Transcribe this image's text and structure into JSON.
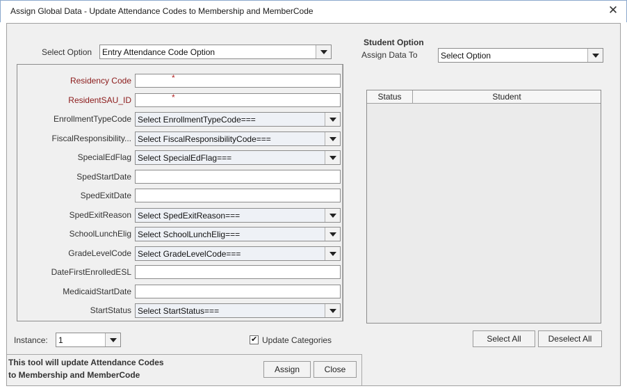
{
  "window": {
    "title": "Assign Global Data - Update Attendance Codes to Membership and MemberCode",
    "close_glyph": "✕"
  },
  "left": {
    "select_option_label": "Select Option",
    "select_option_value": "Entry Attendance Code Option",
    "fields": [
      {
        "label": "Residency Code",
        "type": "text",
        "value": "",
        "required": true
      },
      {
        "label": "ResidentSAU_ID",
        "type": "text",
        "value": "",
        "required": true
      },
      {
        "label": "EnrollmentTypeCode",
        "type": "combo",
        "value": "Select EnrollmentTypeCode==="
      },
      {
        "label": "FiscalResponsibility...",
        "type": "combo",
        "value": "Select FiscalResponsibilityCode==="
      },
      {
        "label": "SpecialEdFlag",
        "type": "combo",
        "value": "Select SpecialEdFlag==="
      },
      {
        "label": "SpedStartDate",
        "type": "text",
        "value": ""
      },
      {
        "label": "SpedExitDate",
        "type": "text",
        "value": ""
      },
      {
        "label": "SpedExitReason",
        "type": "combo",
        "value": "Select SpedExitReason==="
      },
      {
        "label": "SchoolLunchElig",
        "type": "combo",
        "value": "Select SchoolLunchElig==="
      },
      {
        "label": "GradeLevelCode",
        "type": "combo",
        "value": "Select GradeLevelCode==="
      },
      {
        "label": "DateFirstEnrolledESL",
        "type": "text",
        "value": ""
      },
      {
        "label": "MedicaidStartDate",
        "type": "text",
        "value": ""
      },
      {
        "label": "StartStatus",
        "type": "combo",
        "value": "Select StartStatus==="
      }
    ],
    "required_marker": "*",
    "instance_label": "Instance:",
    "instance_value": "1",
    "update_categories_label": "Update Categories",
    "update_categories_checked": true
  },
  "right": {
    "section_title": "Student Option",
    "assign_data_to_label": "Assign Data To",
    "assign_data_to_value": "Select Option",
    "table_headers": [
      "Status",
      "Student"
    ],
    "select_all_label": "Select All",
    "deselect_all_label": "Deselect All"
  },
  "footer": {
    "info_line1": "This tool will update Attendance Codes",
    "info_line2": "to Membership and MemberCode",
    "assign_label": "Assign",
    "close_label": "Close"
  }
}
